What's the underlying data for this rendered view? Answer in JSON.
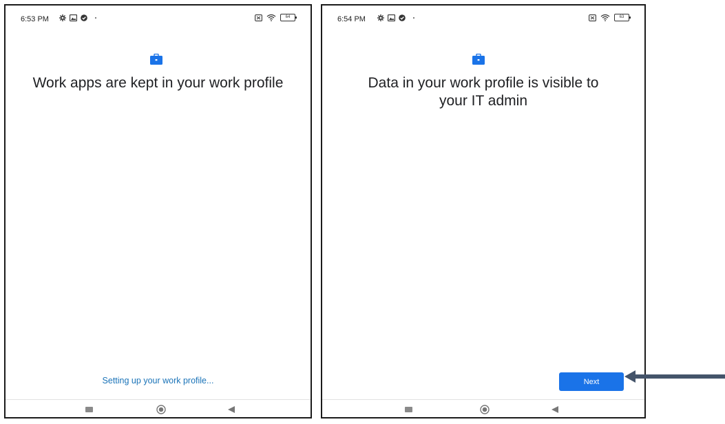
{
  "screens": [
    {
      "status_time": "6:53 PM",
      "battery": "64",
      "title": "Work apps are kept in your work profile",
      "progress_text": "Setting up your work profile..."
    },
    {
      "status_time": "6:54 PM",
      "battery": "63",
      "title": "Data in your work profile is visible to your IT admin",
      "next_label": "Next"
    }
  ],
  "icons": {
    "briefcase": "briefcase-icon",
    "recent": "recent-apps-icon",
    "home": "home-icon",
    "back": "back-icon",
    "annotation": "arrow-left-icon"
  },
  "colors": {
    "accent": "#1a73e8",
    "progress_text": "#1a73b8",
    "annotation_arrow": "#44546a"
  }
}
